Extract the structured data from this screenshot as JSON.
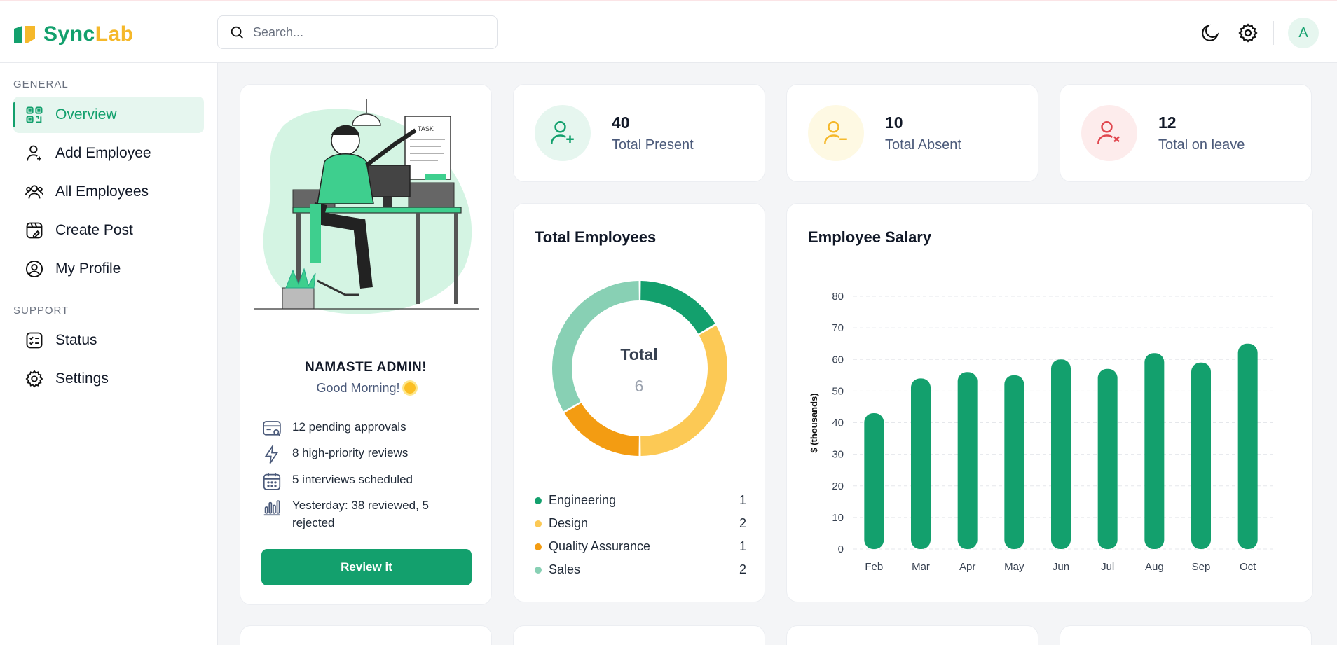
{
  "app": {
    "logo_part1": "Sync",
    "logo_part2": "Lab",
    "brand_color": "#13a06d",
    "accent_color": "#f5b82a"
  },
  "search": {
    "placeholder": "Search..."
  },
  "header": {
    "avatar_letter": "A"
  },
  "sidebar": {
    "general_label": "GENERAL",
    "support_label": "SUPPORT",
    "items": [
      {
        "label": "Overview",
        "icon": "grid-icon",
        "active": true
      },
      {
        "label": "Add Employee",
        "icon": "user-add-icon"
      },
      {
        "label": "All Employees",
        "icon": "users-icon"
      },
      {
        "label": "Create Post",
        "icon": "post-icon"
      },
      {
        "label": "My Profile",
        "icon": "profile-icon"
      },
      {
        "label": "Status",
        "icon": "checklist-icon"
      },
      {
        "label": "Settings",
        "icon": "gear-icon"
      }
    ]
  },
  "welcome": {
    "title": "NAMASTE ADMIN!",
    "subtitle": "Good Morning!",
    "tasks": [
      {
        "text": "12 pending approvals",
        "icon": "card-search-icon"
      },
      {
        "text": "8 high-priority reviews",
        "icon": "lightning-icon"
      },
      {
        "text": "5 interviews scheduled",
        "icon": "calendar-icon"
      },
      {
        "text": "Yesterday: 38 reviewed, 5 rejected",
        "icon": "bar-chart-icon"
      }
    ],
    "button": "Review it"
  },
  "stats": [
    {
      "value": "40",
      "label": "Total Present",
      "bg": "#e6f6ef",
      "color": "#13a06d",
      "icon": "user-plus-icon"
    },
    {
      "value": "10",
      "label": "Total Absent",
      "bg": "#fef9e3",
      "color": "#f5b82a",
      "icon": "user-minus-icon"
    },
    {
      "value": "12",
      "label": "Total on leave",
      "bg": "#fdecec",
      "color": "#e0464e",
      "icon": "user-x-icon"
    }
  ],
  "employees": {
    "title": "Total Employees",
    "center_label": "Total",
    "center_value": "6"
  },
  "salary": {
    "title": "Employee Salary"
  },
  "chart_data": [
    {
      "type": "pie",
      "title": "Total Employees",
      "categories": [
        "Engineering",
        "Design",
        "Quality Assurance",
        "Sales"
      ],
      "values": [
        1,
        2,
        1,
        2
      ],
      "colors": [
        "#13a06d",
        "#fcc955",
        "#f39c12",
        "#88d0b4"
      ],
      "total": 6
    },
    {
      "type": "bar",
      "title": "Employee Salary",
      "categories": [
        "Feb",
        "Mar",
        "Apr",
        "May",
        "Jun",
        "Jul",
        "Aug",
        "Sep",
        "Oct"
      ],
      "values": [
        43,
        54,
        56,
        55,
        60,
        57,
        62,
        59,
        65
      ],
      "ylabel": "$ (thousands)",
      "ylim": [
        0,
        80
      ],
      "yticks": [
        0,
        10,
        20,
        30,
        40,
        50,
        60,
        70,
        80
      ],
      "color": "#13a06d",
      "grid": true
    }
  ]
}
